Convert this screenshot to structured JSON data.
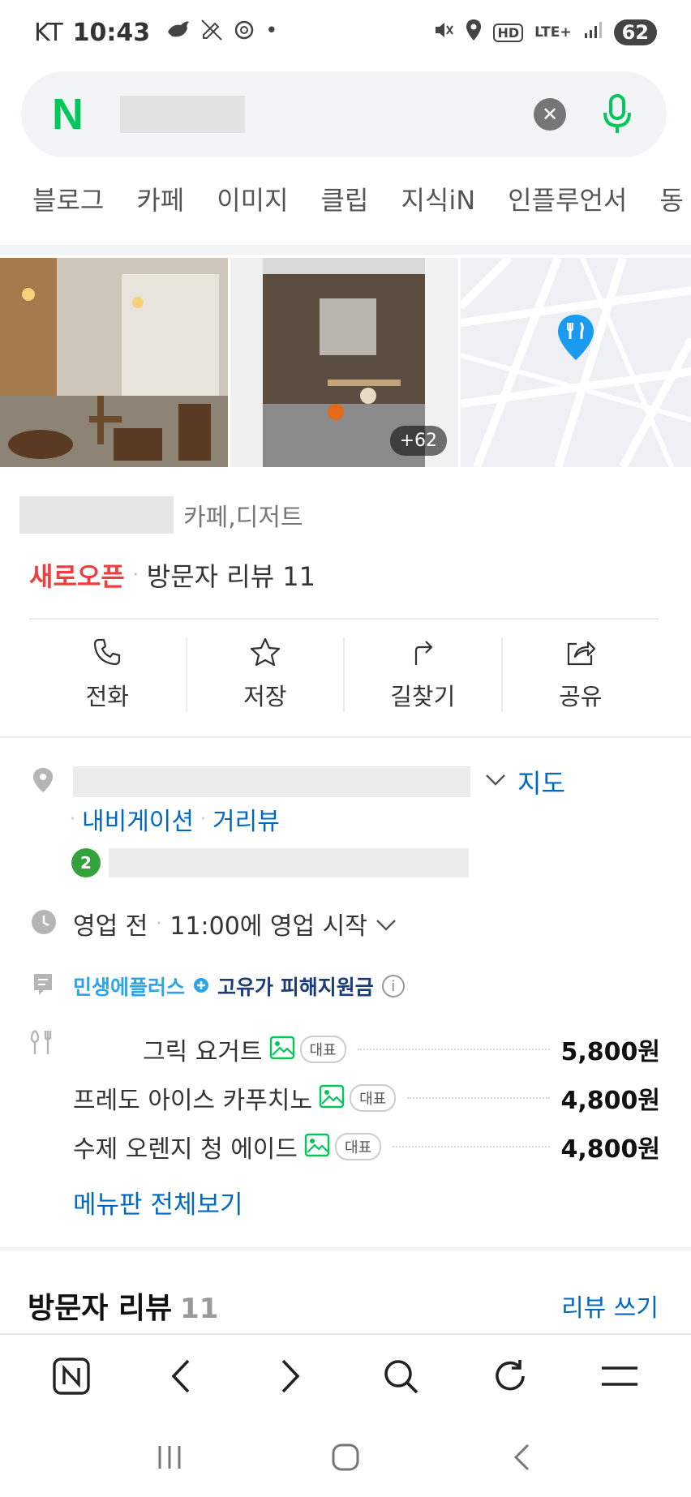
{
  "status_bar": {
    "carrier": "KT",
    "time": "10:43",
    "network": "LTE+",
    "hd": "HD",
    "battery": "62",
    "dot": "•"
  },
  "search": {
    "logo": "N",
    "clear_icon": "✕"
  },
  "tabs": [
    "블로그",
    "카페",
    "이미지",
    "클립",
    "지식iN",
    "인플루언서",
    "동"
  ],
  "photos": {
    "more_count": "+62"
  },
  "place": {
    "category": "카페,디저트",
    "badge": "새로오픈",
    "separator": "·",
    "review_count_text": "방문자 리뷰 11"
  },
  "actions": [
    {
      "label": "전화",
      "icon": "phone-icon"
    },
    {
      "label": "저장",
      "icon": "star-icon"
    },
    {
      "label": "길찾기",
      "icon": "directions-icon"
    },
    {
      "label": "공유",
      "icon": "share-icon"
    }
  ],
  "address": {
    "map_link": "지도",
    "navigation": "내비게이션",
    "street_view": "거리뷰",
    "subway_line": "2"
  },
  "hours": {
    "status": "영업 전",
    "detail": "11:00에 영업 시작"
  },
  "notice": {
    "brand": "민생에플러스",
    "text": "고유가 피해지원금",
    "info": "i"
  },
  "menu": {
    "items": [
      {
        "name": "그릭 요거트",
        "badge": "대표",
        "price": "5,800원"
      },
      {
        "name": "프레도 아이스 카푸치노",
        "badge": "대표",
        "price": "4,800원"
      },
      {
        "name": "수제 오렌지 청 에이드",
        "badge": "대표",
        "price": "4,800원"
      }
    ],
    "view_all": "메뉴판 전체보기"
  },
  "reviews": {
    "title": "방문자 리뷰",
    "count": "11",
    "write": "리뷰 쓰기"
  },
  "colors": {
    "brand_green": "#03c75a",
    "link_blue": "#0068c3",
    "new_open_red": "#f03e3e",
    "map_pin_blue": "#1a9bf0"
  }
}
